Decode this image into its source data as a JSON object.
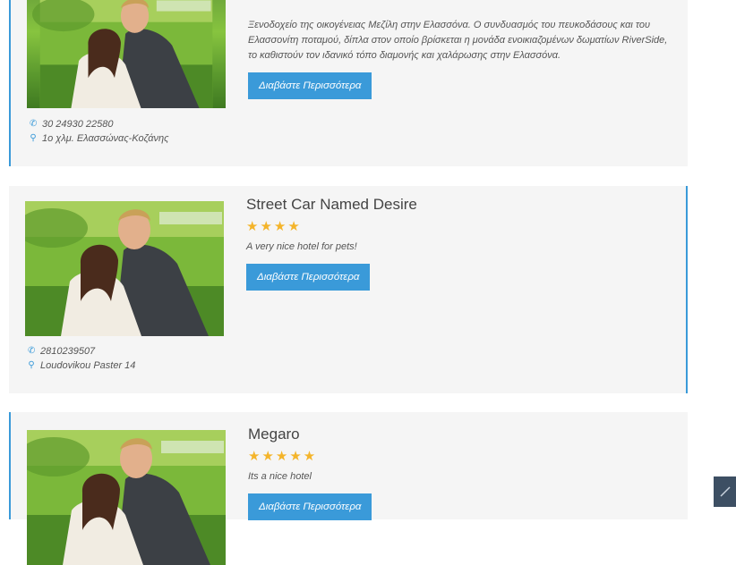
{
  "listings": [
    {
      "title": "",
      "rating": 0,
      "stars": "",
      "description": "Ξενοδοχείο της οικογένειας Μεζίλη στην Ελασσόνα. Ο συνδυασμός του πευκοδάσους και του Ελασσονίτη ποταμού, δίπλα στον οποίο βρίσκεται η μονάδα ενοικιαζομένων δωματίων RiverSide, το καθιστούν τον ιδανικό τόπο διαμονής και χαλάρωσης στην Ελασσόνα.",
      "button_label": "Διαβάστε Περισσότερα",
      "phone": "30 24930 22580",
      "address": "1ο χλμ. Ελασσώνας-Κοζάνης"
    },
    {
      "title": "Street Car Named Desire",
      "rating": 4,
      "stars": "★★★★",
      "description": "A very nice hotel for pets!",
      "button_label": "Διαβάστε Περισσότερα",
      "phone": "2810239507",
      "address": "Loudovikou Paster 14"
    },
    {
      "title": "Megaro",
      "rating": 5,
      "stars": "★★★★★",
      "description": "Its a nice hotel",
      "button_label": "Διαβάστε Περισσότερα"
    }
  ],
  "icons": {
    "phone": "phone-icon",
    "location": "map-marker-icon",
    "scroll_top": "arrow-up-icon"
  },
  "colors": {
    "accent": "#3a9ad9",
    "star": "#f4b42a",
    "card_bg": "#f5f5f5",
    "corner_button": "#3d4f63"
  }
}
